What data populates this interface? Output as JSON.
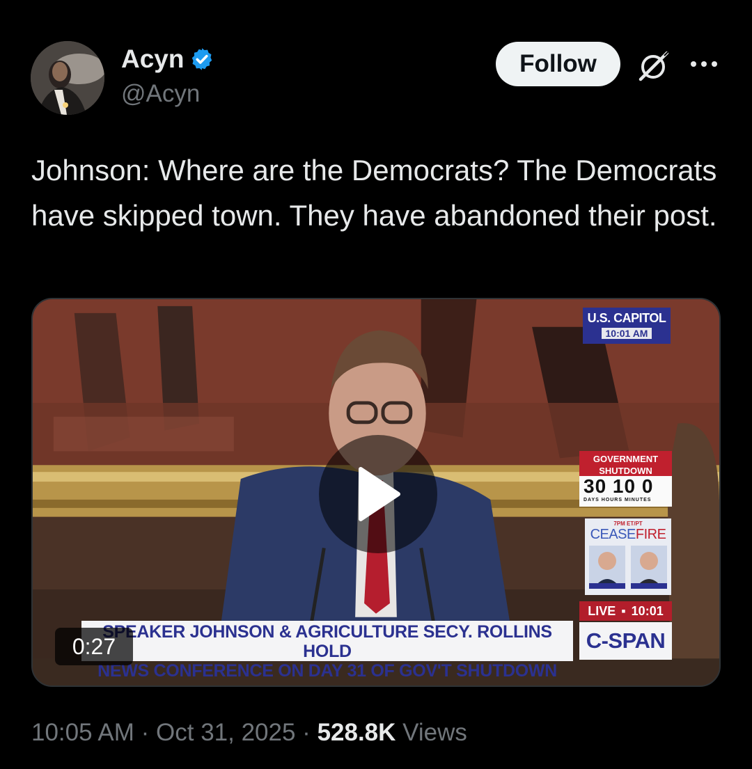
{
  "author": {
    "display_name": "Acyn",
    "handle": "@Acyn",
    "verified_color": "#1d9bf0"
  },
  "actions": {
    "follow_label": "Follow",
    "grok_icon": "grok-icon",
    "more_icon": "more-icon"
  },
  "tweet": {
    "text": "Johnson: Where are the Democrats? The Democrats have skipped town. They have abandoned their post."
  },
  "video": {
    "duration": "0:27",
    "overlay": {
      "location": "U.S. CAPITOL",
      "location_time": "10:01 AM",
      "shutdown_title": "GOVERNMENT SHUTDOWN",
      "counter": "30 10  0",
      "counter_units": "DAYS  HOURS  MINUTES",
      "show_schedule": "7PM ET/PT",
      "show_title_a": "CEASE",
      "show_title_b": "FIRE",
      "live_label": "LIVE",
      "live_time": "10:01",
      "chyron_line1": "SPEAKER JOHNSON & AGRICULTURE SECY. ROLLINS HOLD",
      "chyron_line2": "NEWS CONFERENCE ON DAY 31 OF GOV'T SHUTDOWN",
      "network": "C-SPAN"
    }
  },
  "meta": {
    "time": "10:05 AM",
    "separator": "·",
    "date": "Oct 31, 2025",
    "views_count": "528.8K",
    "views_label": "Views"
  }
}
